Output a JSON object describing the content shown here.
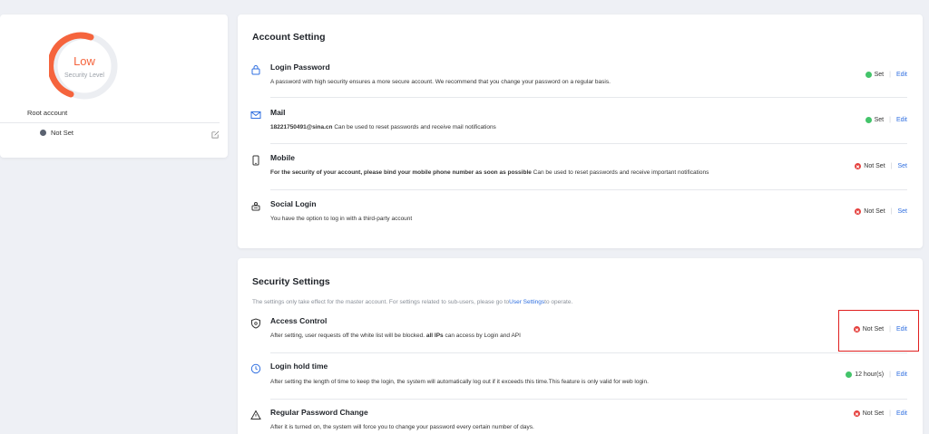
{
  "security_level": {
    "level": "Low",
    "caption": "Security Level",
    "account_label": "Root account",
    "account_status": "Not Set"
  },
  "account_setting": {
    "title": "Account Setting",
    "rows": [
      {
        "icon": "lock-icon",
        "title": "Login Password",
        "desc": "A password with high security ensures a more secure account. We recommend that you change your password on a regular basis.",
        "status": "Set",
        "status_type": "ok",
        "action": "Edit"
      },
      {
        "icon": "mail-icon",
        "title": "Mail",
        "desc_bold": "18221750491@sina.cn",
        "desc": " Can be used to reset passwords and receive mail notifications",
        "status": "Set",
        "status_type": "ok",
        "action": "Edit"
      },
      {
        "icon": "mobile-icon",
        "title": "Mobile",
        "desc_bold": "For the security of your account, please bind your mobile phone number as soon as possible",
        "desc": " Can be used to reset passwords and receive important notifications",
        "status": "Not Set",
        "status_type": "bad",
        "action": "Set"
      },
      {
        "icon": "social-icon",
        "title": "Social Login",
        "desc": "You have the option to log in with a third-party account",
        "status": "Not Set",
        "status_type": "bad",
        "action": "Set"
      }
    ]
  },
  "security_settings": {
    "title": "Security Settings",
    "notice_prefix": "The settings only take effect for the master account. For settings related to sub-users, please go to",
    "notice_link": "User Settings",
    "notice_suffix": "to operate.",
    "rows": [
      {
        "icon": "shield-icon",
        "title": "Access Control",
        "desc_prefix": "After setting, user requests off the white list will be blocked. ",
        "desc_bold": "all IPs",
        "desc_suffix": " can access by Login and API",
        "status": "Not Set",
        "status_type": "bad",
        "action": "Edit"
      },
      {
        "icon": "clock-icon",
        "title": "Login hold time",
        "desc": "After setting the length of time to keep the login, the system will automatically log out if it exceeds this time.This feature is only valid for web login.",
        "status": "12 hour(s)",
        "status_type": "ok",
        "action": "Edit"
      },
      {
        "icon": "warning-icon",
        "title": "Regular Password Change",
        "desc": "After it is turned on, the system will force you to change your password every certain number of days.",
        "status": "Not Set",
        "status_type": "bad",
        "action": "Edit"
      }
    ]
  },
  "colors": {
    "accent": "#2f6fe0",
    "ok": "#43c46a",
    "bad": "#e5403d",
    "gauge": "#f5643d",
    "highlight": "#e02020"
  }
}
